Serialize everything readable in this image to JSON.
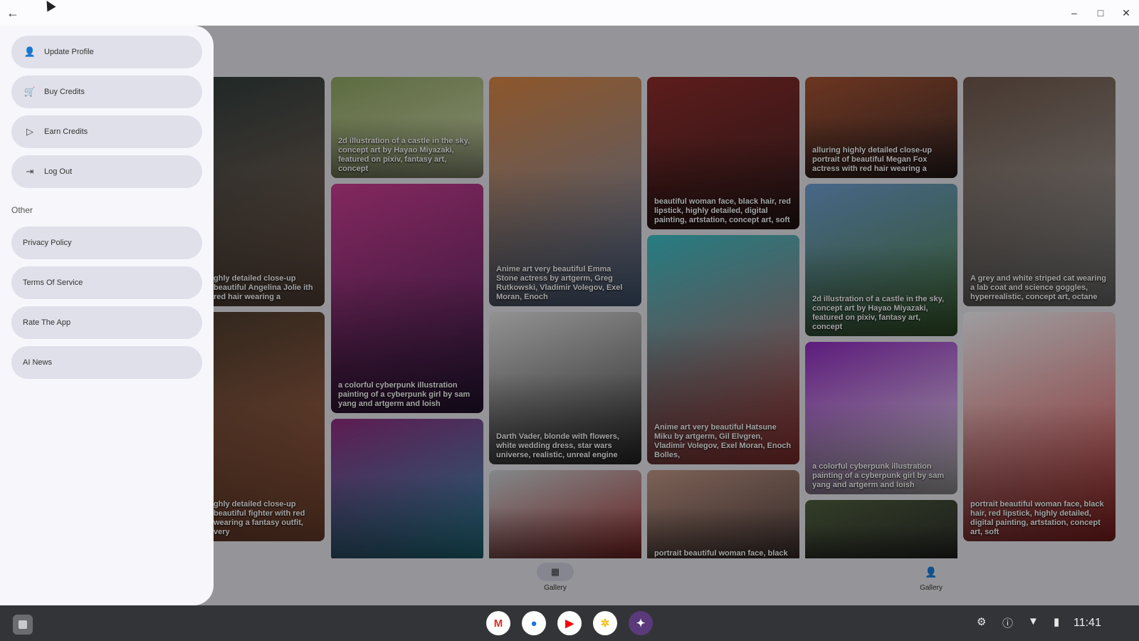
{
  "window": {
    "back_icon": "arrow-left-icon",
    "min": "–",
    "max": "□",
    "close": "✕"
  },
  "drawer": {
    "items": [
      {
        "label": "Update Profile",
        "icon": "person-icon",
        "glyph": "👤"
      },
      {
        "label": "Buy Credits",
        "icon": "cart-icon",
        "glyph": "🛒"
      },
      {
        "label": "Earn Credits",
        "icon": "play-icon",
        "glyph": "▷"
      },
      {
        "label": "Log Out",
        "icon": "logout-icon",
        "glyph": "⇥"
      }
    ],
    "section_label": "Other",
    "other_items": [
      {
        "label": "Privacy Policy"
      },
      {
        "label": "Terms Of Service"
      },
      {
        "label": "Rate The App"
      },
      {
        "label": "AI News"
      }
    ]
  },
  "gallery": {
    "cards": [
      {
        "caption": "ghly detailed close-up beautiful Angelina Jolie ith red hair wearing a",
        "colors": [
          "#2f3b3a",
          "#8a6a5a"
        ]
      },
      {
        "caption": "ghly detailed close-up beautiful fighter with red wearing a fantasy outfit, very",
        "colors": [
          "#4a3a2c",
          "#b86a4a"
        ]
      },
      {
        "caption": "2d illustration of a castle in the sky, concept art by Hayao Miyazaki, featured on pixiv, fantasy art, concept",
        "colors": [
          "#8aa060",
          "#c9d0a8"
        ]
      },
      {
        "caption": "a colorful cyberpunk illustration painting of a cyberpunk girl by sam yang and artgerm and loish",
        "colors": [
          "#c23b8c",
          "#3a1f4f"
        ]
      },
      {
        "caption": "",
        "colors": [
          "#8a2a7a",
          "#2a9ab0"
        ]
      },
      {
        "caption": "Anime art very beautiful Emma Stone actress by artgerm, Greg Rutkowski, Vladimir Volegov, Exel Moran, Enoch",
        "colors": [
          "#d08040",
          "#6a8ab8"
        ]
      },
      {
        "caption": "Darth Vader, blonde with flowers, white wedding dress, star wars universe, realistic, unreal engine",
        "colors": [
          "#d8d8d8",
          "#3a3a3a"
        ]
      },
      {
        "caption": "",
        "colors": [
          "#c2c9cc",
          "#9a2a2a"
        ]
      },
      {
        "caption": "beautiful woman face, black hair, red lipstick, highly detailed, digital painting, artstation, concept art, soft",
        "colors": [
          "#8a2a2a",
          "#3a2020"
        ]
      },
      {
        "caption": "Anime art very beautiful Hatsune Miku by artgerm, Gil Elvgren, Vladimir Volegov, Exel Moran, Enoch Bolles,",
        "colors": [
          "#38b8c0",
          "#d84848"
        ]
      },
      {
        "caption": "portrait beautiful woman face, black",
        "colors": [
          "#b89080",
          "#4a3a38"
        ]
      },
      {
        "caption": "alluring highly detailed close-up portrait of beautiful Megan Fox actress with red hair wearing a",
        "colors": [
          "#a05030",
          "#3a2a2a"
        ]
      },
      {
        "caption": "2d illustration of a castle in the sky, concept art by Hayao Miyazaki, featured on pixiv, fantasy art, concept",
        "colors": [
          "#6a98c8",
          "#4a7a3a"
        ]
      },
      {
        "caption": "a colorful cyberpunk illustration painting of a cyberpunk girl by sam yang and artgerm and loish",
        "colors": [
          "#8a2ab8",
          "#f0f0f0"
        ]
      },
      {
        "caption": "",
        "colors": [
          "#4a5a3a",
          "#2a2a2a"
        ]
      },
      {
        "caption": "A grey and white striped cat wearing a lab coat and science goggles, hyperrealistic, concept art, octane",
        "colors": [
          "#6a5448",
          "#a8a8a8"
        ]
      },
      {
        "caption": "portrait beautiful woman face, black hair, red lipstick, highly detailed, digital painting, artstation, concept art, soft",
        "colors": [
          "#e8e8ec",
          "#c83030"
        ]
      }
    ]
  },
  "bottom_nav": [
    {
      "label": "Gallery",
      "icon": "gallery-icon",
      "glyph": "▦"
    },
    {
      "label": "Gallery",
      "icon": "person-icon",
      "glyph": "👤"
    }
  ],
  "shelf": {
    "apps": [
      {
        "name": "gmail-icon",
        "glyph": "M",
        "bg": "#ffffff",
        "fg": "#d93025"
      },
      {
        "name": "chrome-icon",
        "glyph": "●",
        "bg": "#ffffff",
        "fg": "#1a73e8"
      },
      {
        "name": "youtube-icon",
        "glyph": "▶",
        "bg": "#ffffff",
        "fg": "#ff0000"
      },
      {
        "name": "photos-icon",
        "glyph": "✲",
        "bg": "#ffffff",
        "fg": "#fbbc04"
      },
      {
        "name": "app-icon",
        "glyph": "✦",
        "bg": "#5a3a7a",
        "fg": "#ffffff"
      }
    ],
    "tray_icons": [
      {
        "name": "settings-icon",
        "glyph": "⚙"
      },
      {
        "name": "info-icon",
        "glyph": "ⓘ"
      },
      {
        "name": "wifi-icon",
        "glyph": "▼"
      },
      {
        "name": "battery-icon",
        "glyph": "▮"
      }
    ],
    "time": "11:41"
  }
}
